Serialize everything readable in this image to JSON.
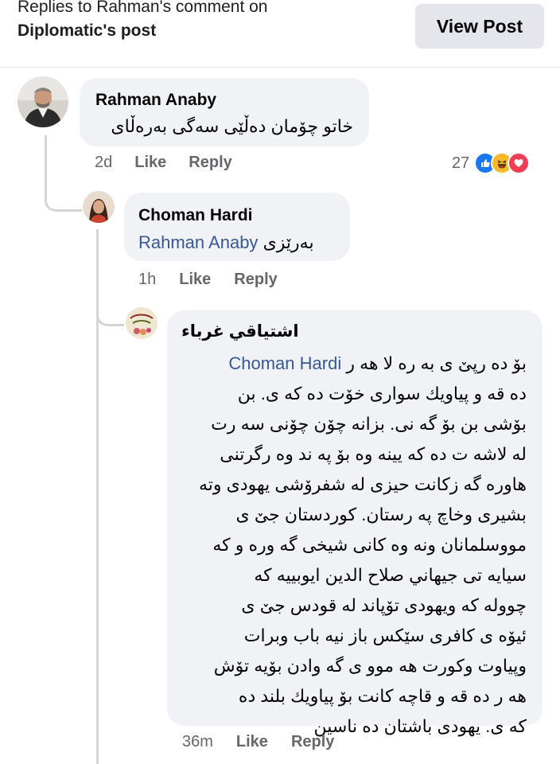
{
  "header": {
    "title_line1": "Replies to Rahman's comment on",
    "title_line2": "Diplomatic's post",
    "view_post_label": "View Post"
  },
  "colors": {
    "bubble_bg": "#f0f2f5",
    "mention": "#385898",
    "like_reaction": "#1877f2",
    "haha_reaction": "#f7b928",
    "love_reaction": "#f33e58"
  },
  "comments": [
    {
      "author": "Rahman Anaby",
      "text": "خاتو چۆمان دەڵێی سەگی بەرەڵای",
      "time": "2d",
      "like_label": "Like",
      "reply_label": "Reply",
      "reaction_count": "27",
      "reaction_icons": [
        "like-icon",
        "haha-icon",
        "love-icon"
      ]
    },
    {
      "author": "Choman Hardi",
      "mention": "Rahman Anaby",
      "text": "بەرێزی",
      "time": "1h",
      "like_label": "Like",
      "reply_label": "Reply"
    },
    {
      "author": "اشتیاقي غرباء",
      "mention": "Choman Hardi",
      "first_line": "بۆ ده رپێ ی  به ره لا هه ر",
      "lines": [
        "ده قه و پیاویك سواری خۆت ده كه ی. بن",
        "بۆشی بن بۆ گه نی. بزانه چۆن چۆنی سه رت",
        "له لاشه ت ده كه یینه وه بۆ  په ند وه رگرتنی",
        "هاوره گه زكانت حیزی له شفرۆشی یهودی وته",
        "بشیری وخاچ په رستان. كوردستان جێ ی",
        "مووسلمانان ونه وه كانی شیخی گه وره و كه",
        "سیایه تی جیهاني صلاح الدين ايوبييه كه",
        "چووله كه ویهودی تۆپاند له قودس جێ ی",
        "ئیۆه ی كافری سێكس باز نیه باب وبرات",
        "وپیاوت وكورت هه موو ی گه وادن بۆیه تۆش",
        "هه ر ده قه و قاچه كانت بۆ پیاویك بلند ده",
        "كه ی. یهودی باشتان ده ناسین"
      ],
      "time": "36m",
      "like_label": "Like",
      "reply_label": "Reply"
    }
  ]
}
